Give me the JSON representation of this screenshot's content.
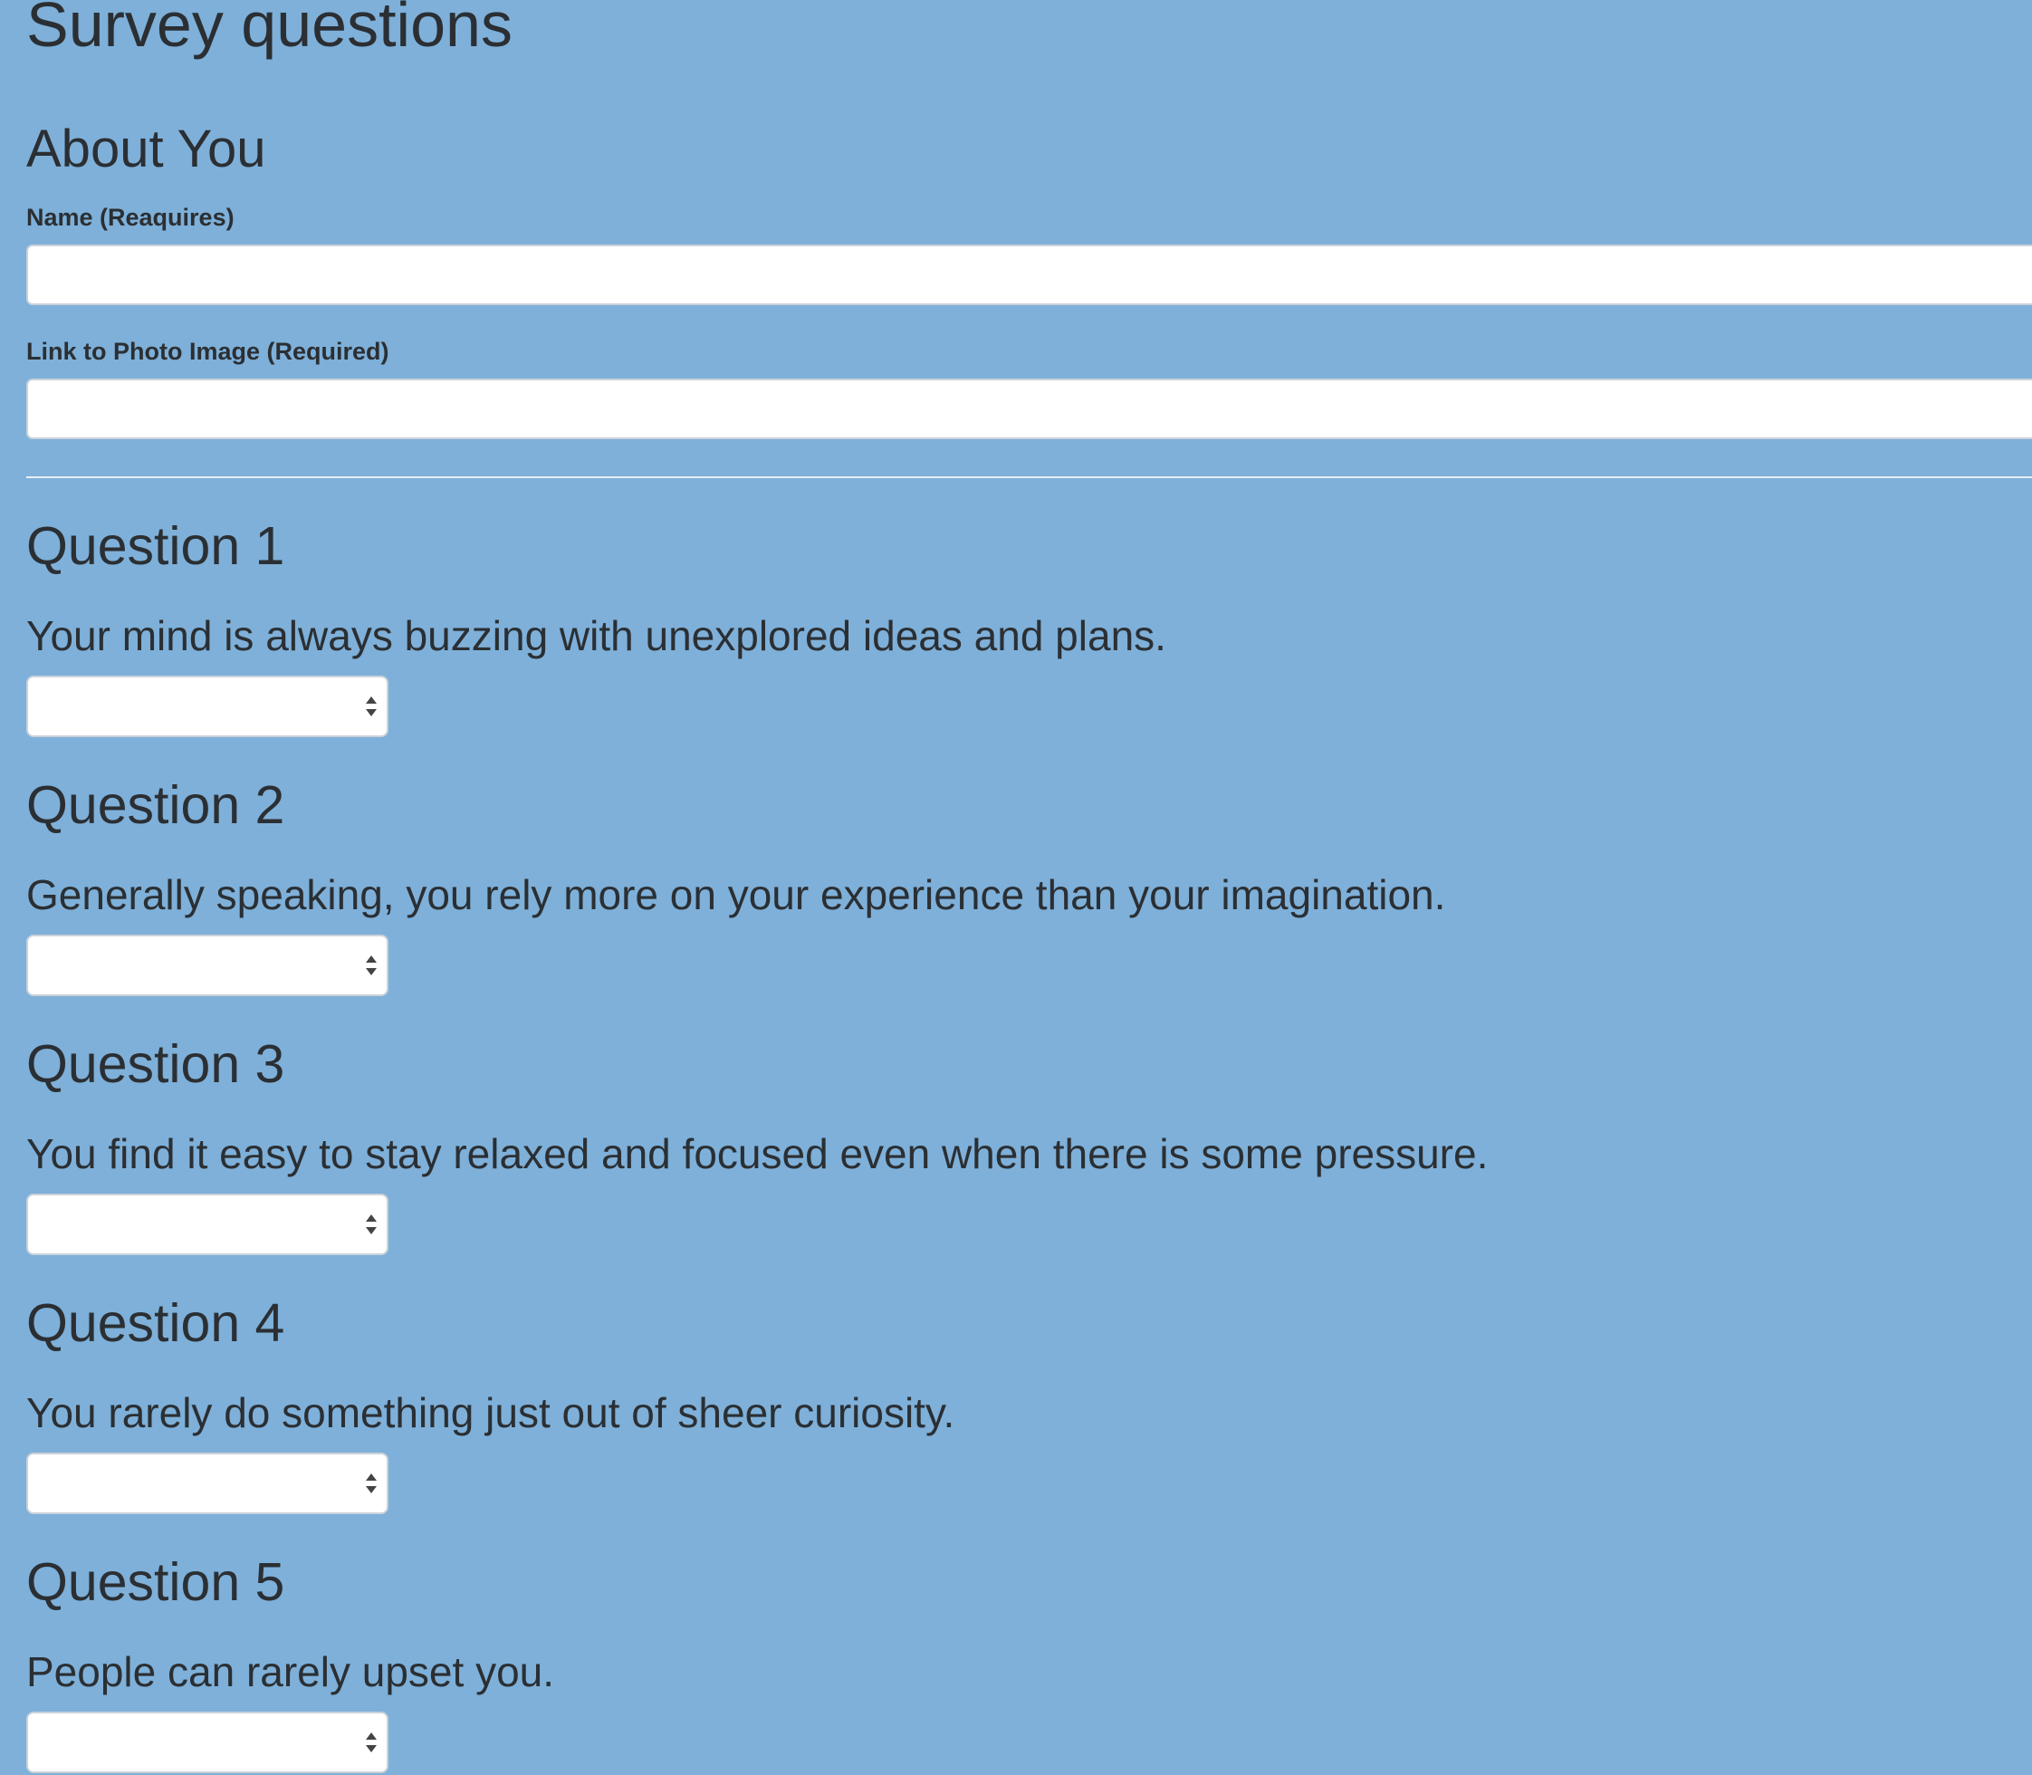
{
  "page": {
    "title": "Survey questions"
  },
  "about": {
    "title": "About You",
    "name_label": "Name (Reaquires)",
    "name_value": "",
    "photo_label": "Link to Photo Image (Required)",
    "photo_value": ""
  },
  "questions": [
    {
      "title": "Question 1",
      "text": "Your mind is always buzzing with unexplored ideas and plans.",
      "selected": ""
    },
    {
      "title": "Question 2",
      "text": "Generally speaking, you rely more on your experience than your imagination.",
      "selected": ""
    },
    {
      "title": "Question 3",
      "text": "You find it easy to stay relaxed and focused even when there is some pressure.",
      "selected": ""
    },
    {
      "title": "Question 4",
      "text": "You rarely do something just out of sheer curiosity.",
      "selected": ""
    },
    {
      "title": "Question 5",
      "text": "People can rarely upset you.",
      "selected": ""
    }
  ],
  "icons": {
    "select": "up-down-arrows-icon"
  },
  "colors": {
    "background": "#7eb0d9",
    "text": "#2b2f33",
    "input_bg": "#ffffff",
    "divider": "#e8f0f7"
  }
}
